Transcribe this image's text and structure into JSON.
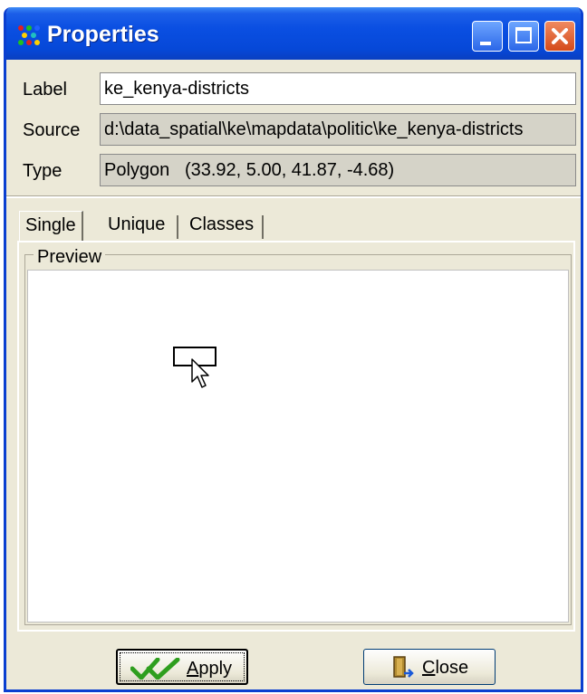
{
  "window": {
    "title": "Properties",
    "icon": "app-dots-icon",
    "controls": {
      "minimize": "minimize-icon",
      "maximize": "maximize-icon",
      "close": "close-icon"
    }
  },
  "fields": {
    "label": {
      "caption": "Label",
      "value": "ke_kenya-districts"
    },
    "source": {
      "caption": "Source",
      "value": "d:\\data_spatial\\ke\\mapdata\\politic\\ke_kenya-districts"
    },
    "type": {
      "caption": "Type",
      "value": "Polygon   (33.92, 5.00, 41.87, -4.68)"
    }
  },
  "tabs": [
    {
      "label": "Single",
      "active": true
    },
    {
      "label": "Unique",
      "active": false
    },
    {
      "label": "Classes",
      "active": false
    }
  ],
  "preview": {
    "title": "Preview"
  },
  "buttons": {
    "apply": {
      "label_rest": "pply",
      "label_mnemonic": "A",
      "icon": "double-checkmark-icon"
    },
    "close": {
      "label_rest": "lose",
      "label_mnemonic": "C",
      "icon": "door-exit-icon"
    }
  },
  "colors": {
    "titlebar": "#0648d8",
    "dialog_bg": "#ece9d8",
    "apply_check": "#2e9e1e"
  }
}
